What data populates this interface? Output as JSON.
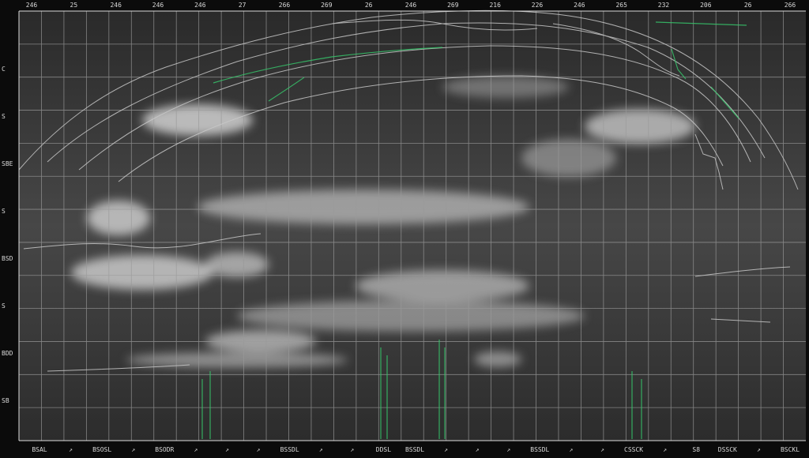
{
  "top_labels": [
    "246",
    "25",
    "246",
    "246",
    "246",
    "27",
    "266",
    "269",
    "26",
    "246",
    "269",
    "216",
    "226",
    "246",
    "265",
    "232",
    "206",
    "26",
    "266"
  ],
  "bottom_labels": [
    "BSAL",
    "↗",
    "BSOSL",
    "↗",
    "BSODR",
    "↗",
    "↗",
    "↗",
    "BSSDL",
    "↗",
    "↗",
    "DDSL",
    "BSSDL",
    "↗",
    "↗",
    "↗",
    "BSSDL",
    "↗",
    "↗",
    "CSSCK",
    "↗",
    "S8",
    "DSSCK",
    "↗",
    "BSCKL"
  ],
  "left_labels": [
    "C",
    "S",
    "SBE",
    "S",
    "BSD",
    "S",
    "BDD",
    "SB"
  ],
  "colors": {
    "background": "#0b0b0b",
    "panel": "#3e3e3e",
    "grid": "#9a9a9a",
    "trace": "#bfbfbf",
    "accent": "#37c36a",
    "cloud": "#e6e6e6"
  }
}
